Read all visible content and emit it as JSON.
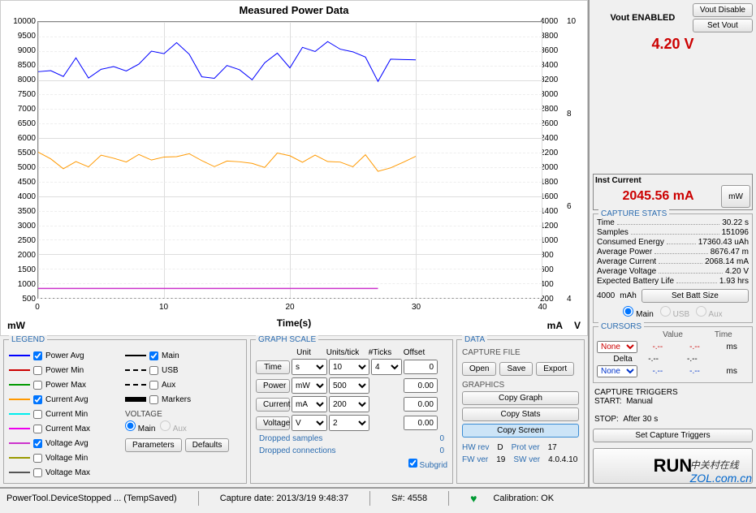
{
  "chart": {
    "title": "Measured Power Data",
    "xlabel": "Time(s)",
    "unit_left": "mW",
    "unit_right1": "mA",
    "unit_right2": "V"
  },
  "chart_data": {
    "type": "line",
    "x_range": [
      0,
      40
    ],
    "x_ticks": [
      0,
      10,
      20,
      30,
      40
    ],
    "y_left": {
      "unit": "mW",
      "range": [
        500,
        10000
      ],
      "ticks": [
        500,
        1000,
        1500,
        2000,
        2500,
        3000,
        3500,
        4000,
        4500,
        5000,
        5500,
        6000,
        6500,
        7000,
        7500,
        8000,
        8500,
        9000,
        9500,
        10000
      ]
    },
    "y_right1": {
      "unit": "mA",
      "range": [
        200,
        4000
      ],
      "ticks": [
        200,
        400,
        600,
        800,
        1000,
        1200,
        1400,
        1600,
        1800,
        2000,
        2200,
        2400,
        2600,
        2800,
        3000,
        3200,
        3400,
        3600,
        3800,
        4000
      ]
    },
    "y_right2": {
      "unit": "V",
      "range": [
        4,
        10
      ],
      "ticks": [
        4,
        6,
        8,
        10
      ]
    },
    "series": [
      {
        "name": "Power Avg",
        "color": "#0000ff",
        "axis": "left",
        "approx_range": [
          7500,
          9800
        ],
        "note": "noisy oscillation 0-30s"
      },
      {
        "name": "Current Avg",
        "color": "#ff9900",
        "axis": "right1",
        "approx_range": [
          1800,
          2400
        ],
        "note": "noisy oscillation 0-30s"
      },
      {
        "name": "Voltage Avg",
        "color": "#cc33cc",
        "axis": "right2",
        "approx_values": [
          4.2
        ],
        "note": "flat line at ~4.2V, 0-27s"
      }
    ]
  },
  "legend": {
    "items": [
      {
        "label": "Power Avg",
        "color": "#0000ff",
        "checked": true
      },
      {
        "label": "Power Min",
        "color": "#cc0000",
        "checked": false
      },
      {
        "label": "Power Max",
        "color": "#009900",
        "checked": false
      },
      {
        "label": "Current Avg",
        "color": "#ff9900",
        "checked": true
      },
      {
        "label": "Current Min",
        "color": "#00eeee",
        "checked": false
      },
      {
        "label": "Current Max",
        "color": "#ee00ee",
        "checked": false
      },
      {
        "label": "Voltage Avg",
        "color": "#cc33cc",
        "checked": true
      },
      {
        "label": "Voltage Min",
        "color": "#999900",
        "checked": false
      },
      {
        "label": "Voltage Max",
        "color": "#555555",
        "checked": false
      }
    ],
    "styles": [
      {
        "label": "Main",
        "checked": true,
        "style": "solid"
      },
      {
        "label": "USB",
        "checked": false,
        "style": "dashed"
      },
      {
        "label": "Aux",
        "checked": false,
        "style": "dashed"
      },
      {
        "label": "Markers",
        "checked": false,
        "style": "thick"
      }
    ],
    "voltage_label": "VOLTAGE",
    "voltage_main": "Main",
    "voltage_aux": "Aux",
    "parameters_btn": "Parameters",
    "defaults_btn": "Defaults"
  },
  "scale": {
    "title": "GRAPH SCALE",
    "headers": {
      "unit": "Unit",
      "upt": "Units/tick",
      "ticks": "#Ticks",
      "offset": "Offset"
    },
    "rows": [
      {
        "btn": "Time",
        "unit": "s",
        "upt": "10",
        "ticks": "4",
        "offset": "0"
      },
      {
        "btn": "Power",
        "unit": "mW",
        "upt": "500",
        "ticks": "",
        "offset": "0.00"
      },
      {
        "btn": "Current",
        "unit": "mA",
        "upt": "200",
        "ticks": "",
        "offset": "0.00"
      },
      {
        "btn": "Voltage",
        "unit": "V",
        "upt": "2",
        "ticks": "",
        "offset": "0.00"
      }
    ],
    "dropped_samples": "Dropped samples",
    "dropped_samples_val": "0",
    "dropped_conn": "Dropped connections",
    "dropped_conn_val": "0",
    "subgrid": "Subgrid"
  },
  "data": {
    "title": "DATA",
    "capture_file": "CAPTURE FILE",
    "open": "Open",
    "save": "Save",
    "export": "Export",
    "graphics": "GRAPHICS",
    "copy_graph": "Copy Graph",
    "copy_stats": "Copy Stats",
    "copy_screen": "Copy Screen",
    "hw_rev_label": "HW rev",
    "hw_rev": "D",
    "fw_ver_label": "FW ver",
    "fw_ver": "19",
    "prot_ver_label": "Prot ver",
    "prot_ver": "17",
    "sw_ver_label": "SW ver",
    "sw_ver": "4.0.4.10"
  },
  "side": {
    "vout_label": "Vout    ENABLED",
    "vout_disable": "Vout Disable",
    "set_vout": "Set Vout",
    "vout_value": "4.20   V",
    "inst_label": "Inst Current",
    "inst_value": "2045.56  mA",
    "mw_btn": "mW",
    "stats_title": "CAPTURE STATS",
    "stats": [
      {
        "label": "Time",
        "val": "30.22  s"
      },
      {
        "label": "Samples",
        "val": "151096"
      },
      {
        "label": "Consumed Energy",
        "val": "17360.43  uAh"
      },
      {
        "label": "Average Power",
        "val": "8676.47  m"
      },
      {
        "label": "Average Current",
        "val": "2068.14  mA"
      },
      {
        "label": "Average Voltage",
        "val": "4.20  V"
      },
      {
        "label": "Expected Battery Life",
        "val": "1.93  hrs"
      }
    ],
    "batt_val": "4000",
    "batt_unit": "mAh",
    "set_batt": "Set Batt Size",
    "src_main": "Main",
    "src_usb": "USB",
    "src_aux": "Aux",
    "cursors_title": "CURSORS",
    "cursor_head_value": "Value",
    "cursor_head_time": "Time",
    "cursor_none": "None",
    "cursor_delta": "Delta",
    "cursor_dash": "-.--",
    "cursor_ms": "ms",
    "triggers_title": "CAPTURE TRIGGERS",
    "start_label": "START:",
    "start_val": "Manual",
    "stop_label": "STOP:",
    "stop_val": "After 30 s",
    "set_triggers": "Set Capture Triggers",
    "run": "RUN"
  },
  "status": {
    "device": "PowerTool.DeviceStopped ... (TempSaved)",
    "capture": "Capture date: 2013/3/19 9:48:37",
    "serial": "S#: 4558",
    "calib": "Calibration: OK"
  },
  "panels": {
    "legend": "LEGEND",
    "data": "DATA"
  }
}
